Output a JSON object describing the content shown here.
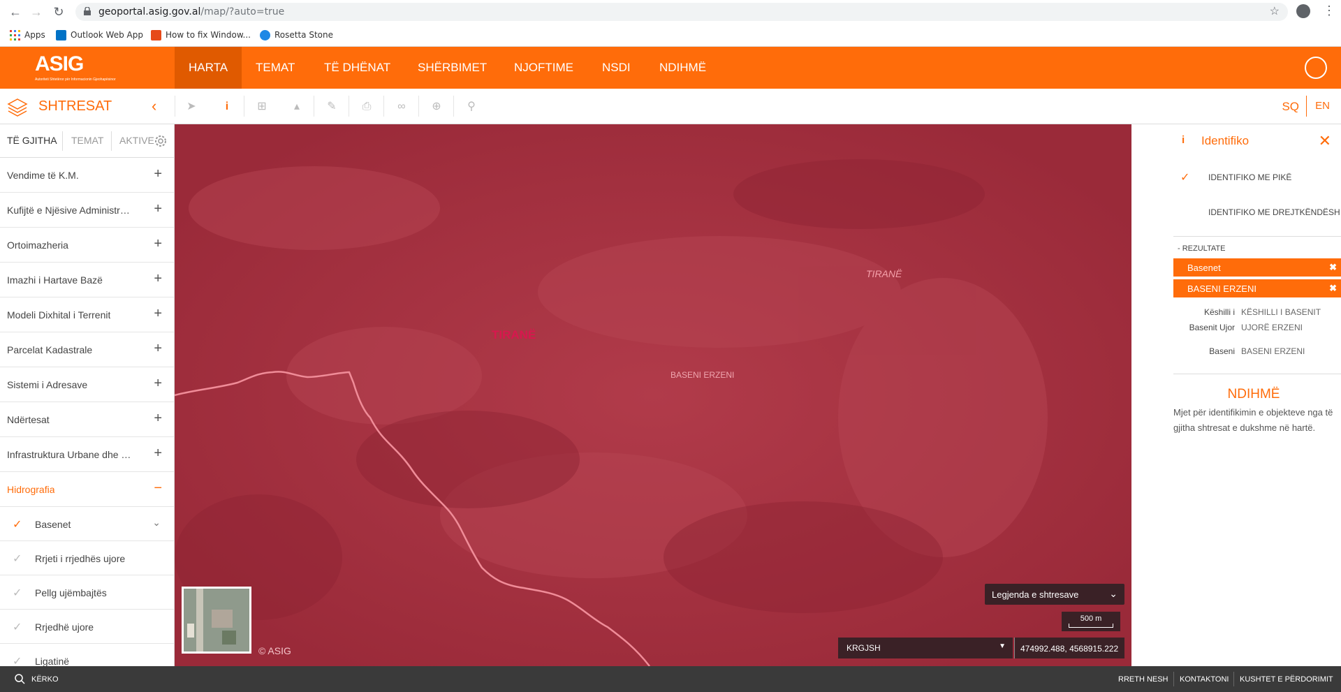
{
  "browser": {
    "url_host": "geoportal.asig.gov.al",
    "url_path": "/map/?auto=true",
    "bookmarks": [
      {
        "label": "Apps",
        "icon": "apps-grid-icon"
      },
      {
        "label": "Outlook Web App",
        "icon": "outlook-icon"
      },
      {
        "label": "How to fix Window...",
        "icon": "bookmark-t-icon"
      },
      {
        "label": "Rosetta Stone",
        "icon": "rosetta-stone-icon"
      }
    ]
  },
  "header": {
    "logo_text": "ASIG",
    "logo_subtitle": "Autoriteti Shtetëror për Informacionin Gjeohapësinor",
    "nav": [
      "HARTA",
      "TEMAT",
      "TË DHËNAT",
      "SHËRBIMET",
      "NJOFTIME",
      "NSDI",
      "NDIHMË"
    ],
    "active_nav": "HARTA"
  },
  "toolbar": {
    "title": "SHTRESAT",
    "lang_sq": "SQ",
    "lang_en": "EN",
    "active_lang": "SQ"
  },
  "sidebar": {
    "tabs": [
      "TË GJITHA",
      "TEMAT",
      "AKTIVE"
    ],
    "active_tab": "TË GJITHA",
    "groups": [
      {
        "label": "Vendime të K.M.",
        "expanded": false
      },
      {
        "label": "Kufijtë e Njësive Administrative",
        "expanded": false
      },
      {
        "label": "Ortoimazheria",
        "expanded": false
      },
      {
        "label": "Imazhi i Hartave Bazë",
        "expanded": false
      },
      {
        "label": "Modeli Dixhital i Terrenit",
        "expanded": false
      },
      {
        "label": "Parcelat Kadastrale",
        "expanded": false
      },
      {
        "label": "Sistemi i Adresave",
        "expanded": false
      },
      {
        "label": "Ndërtesat",
        "expanded": false
      },
      {
        "label": "Infrastruktura Urbane dhe Sociale",
        "expanded": false
      },
      {
        "label": "Hidrografia",
        "expanded": true
      }
    ],
    "sublayers": [
      {
        "label": "Basenet",
        "checked": true
      },
      {
        "label": "Rrjeti i rrjedhës ujore",
        "checked": false
      },
      {
        "label": "Pellg ujëmbajtës",
        "checked": false
      },
      {
        "label": "Rrjedhë ujore",
        "checked": false
      },
      {
        "label": "Ligatinë",
        "checked": false
      }
    ]
  },
  "map": {
    "labels": {
      "tirane_main": "TIRANË",
      "tirane_right": "TIRANË",
      "baseni": "BASENI ERZENI"
    },
    "copyright": "© ASIG",
    "legend_toggle": "Legjenda e shtresave",
    "scale": "500 m",
    "crs": "KRGJSH",
    "coords": "474992.488, 4568915.222",
    "tint_color": "#a8303f"
  },
  "identify_panel": {
    "title": "Identifiko",
    "options": [
      {
        "label": "IDENTIFIKO ME PIKË",
        "checked": true
      },
      {
        "label": "IDENTIFIKO ME DREJTKËNDËSH",
        "checked": false
      }
    ],
    "results_header": "REZULTATE",
    "results": [
      "Basenet",
      "BASENI ERZENI"
    ],
    "attributes": [
      {
        "key": "Këshilli i Basenit Ujor",
        "value": "KËSHILLI I BASENIT UJORË ERZENI"
      },
      {
        "key": "Baseni",
        "value": "BASENI ERZENI"
      }
    ],
    "help_title": "NDIHMË",
    "help_text": "Mjet për identifikimin e objekteve nga të gjitha shtresat e dukshme në hartë."
  },
  "footer": {
    "search": "KËRKO",
    "links": [
      "RRETH NESH",
      "KONTAKTONI",
      "KUSHTET E PËRDORIMIT"
    ]
  },
  "colors": {
    "accent": "#ff6c0a",
    "accent_dark": "#e05a00",
    "map_tint": "#a8303f",
    "map_toolbar": "#3a2126",
    "footer": "#3a3a3a"
  }
}
